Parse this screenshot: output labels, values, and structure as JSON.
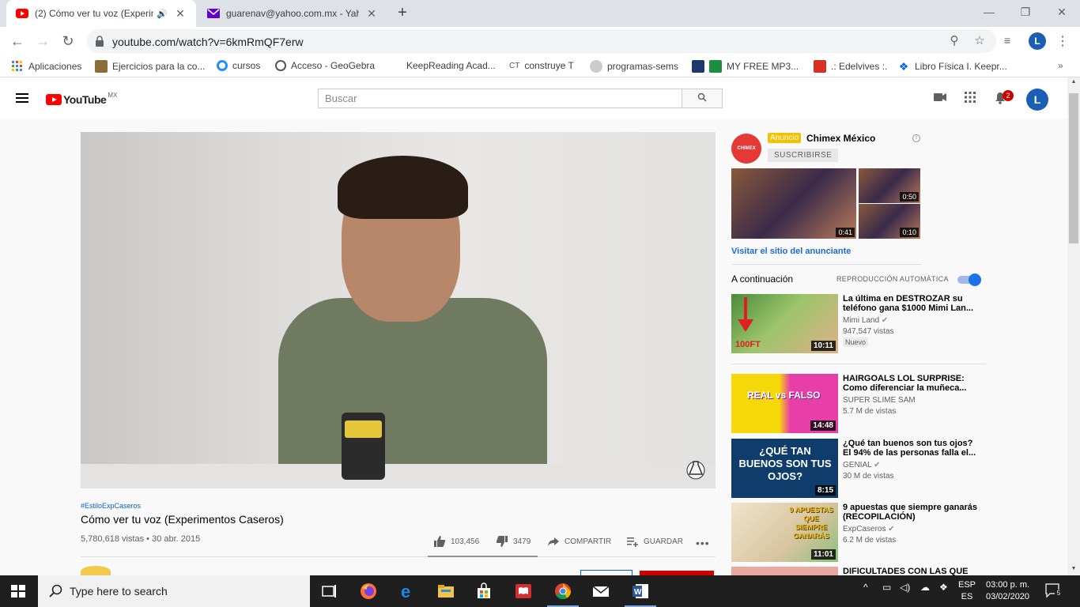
{
  "browser": {
    "tabs": [
      {
        "title": "(2) Cómo ver tu voz (Experim",
        "active": true,
        "favicon": "youtube-favicon"
      },
      {
        "title": "guarenav@yahoo.com.mx - Yaho",
        "active": false,
        "favicon": "yahoo-mail-favicon"
      }
    ],
    "url": "youtube.com/watch?v=6kmRmQF7erw",
    "profile_initial": "L",
    "bookmarks": [
      "Aplicaciones",
      "Ejercicios para la co...",
      "cursos",
      "Acceso - GeoGebra",
      "KeepReading Acad...",
      "construye T",
      "programas-sems",
      "MY FREE MP3...",
      ".: Edelvives :.",
      "Libro Física I. Keepr..."
    ],
    "bookmark_prefix_ct": "CT"
  },
  "youtube": {
    "logo_text": "YouTube",
    "region": "MX",
    "search_placeholder": "Buscar",
    "notifications_count": "2",
    "avatar_initial": "L"
  },
  "video": {
    "hashtag": "#EstiloExpCaseros",
    "title": "Cómo ver tu voz (Experimentos Caseros)",
    "views_date": "5,780,618 vistas • 30 abr. 2015",
    "likes": "103,456",
    "dislikes": "3479",
    "share_label": "COMPARTIR",
    "save_label": "GUARDAR"
  },
  "ad": {
    "badge": "Anuncio",
    "advertiser": "Chimex México",
    "logo_text": "CHIMEX",
    "subscribe": "SUSCRIBIRSE",
    "durations": [
      "0:41",
      "0:50",
      "0:10"
    ],
    "visit_link": "Visitar el sitio del anunciante"
  },
  "upnext": {
    "label": "A continuación",
    "autoplay_label": "REPRODUCCIÓN AUTOMÁTICA",
    "autoplay_on": true
  },
  "recommendations": [
    {
      "title": "La última en DESTROZAR su teléfono gana $1000 Mimi Lan...",
      "channel": "Mimi Land",
      "views": "947,547 vistas",
      "badge": "Nuevo",
      "duration": "10:11",
      "thumb_text": "100FT"
    },
    {
      "title": "HAIRGOALS LOL SURPRISE: Como diferenciar la muñeca...",
      "channel": "SUPER SLIME SAM",
      "views": "5.7 M de vistas",
      "badge": "",
      "duration": "14:48",
      "thumb_text": "REAL vs FALSO"
    },
    {
      "title": "¿Qué tan buenos son tus ojos? El 94% de las personas falla el...",
      "channel": "GENIAL",
      "views": "30 M de vistas",
      "badge": "",
      "duration": "8:15",
      "thumb_text": "¿QUÉ TAN BUENOS SON TUS OJOS?"
    },
    {
      "title": "9 apuestas que siempre ganarás (RECOPILACIÓN)",
      "channel": "ExpCaseros",
      "views": "6.2 M de vistas",
      "badge": "",
      "duration": "11:01",
      "thumb_text": "9 APUESTAS QUE SIEMPRE GANARÁS"
    },
    {
      "title": "DIFICULTADES CON LAS QUE",
      "channel": "",
      "views": "",
      "badge": "",
      "duration": "",
      "thumb_text": ""
    }
  ],
  "taskbar": {
    "search_text": "Type here to search",
    "lang_top": "ESP",
    "lang_bottom": "ES",
    "time": "03:00 p. m.",
    "date": "03/02/2020",
    "notification_count": "5"
  }
}
